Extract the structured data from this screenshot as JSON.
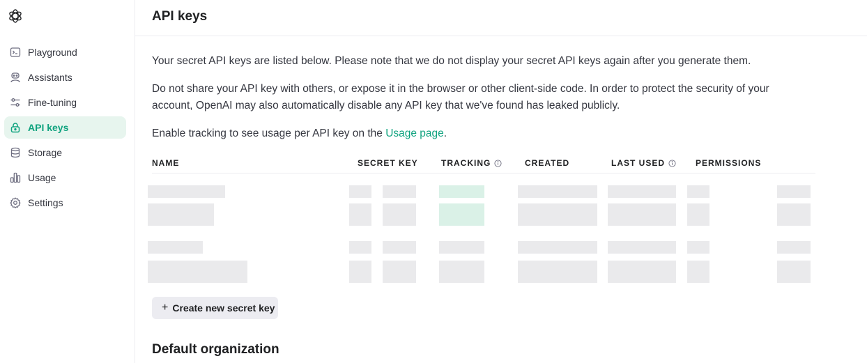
{
  "header": {
    "title": "API keys"
  },
  "sidebar": {
    "items": [
      {
        "label": "Playground",
        "icon": "terminal-icon",
        "active": false
      },
      {
        "label": "Assistants",
        "icon": "robot-icon",
        "active": false
      },
      {
        "label": "Fine-tuning",
        "icon": "sliders-icon",
        "active": false
      },
      {
        "label": "API keys",
        "icon": "lock-icon",
        "active": true
      },
      {
        "label": "Storage",
        "icon": "database-icon",
        "active": false
      },
      {
        "label": "Usage",
        "icon": "bar-chart-icon",
        "active": false
      },
      {
        "label": "Settings",
        "icon": "gear-icon",
        "active": false
      }
    ]
  },
  "main": {
    "intro": "Your secret API keys are listed below. Please note that we do not display your secret API keys again after you generate them.",
    "warning": "Do not share your API key with others, or expose it in the browser or other client-side code. In order to protect the security of your account, OpenAI may also automatically disable any API key that we've found has leaked publicly.",
    "tracking_prefix": "Enable tracking to see usage per API key on the ",
    "tracking_link": "Usage page",
    "tracking_suffix": ".",
    "table": {
      "columns": [
        "NAME",
        "SECRET KEY",
        "TRACKING",
        "CREATED",
        "LAST USED",
        "PERMISSIONS"
      ]
    },
    "create_button": "Create new secret key",
    "org_title": "Default organization"
  },
  "colors": {
    "accent": "#10a37f",
    "active_bg": "#e7f5ee",
    "redacted": "#e6e6e9",
    "redacted_green": "#d3eee3"
  }
}
